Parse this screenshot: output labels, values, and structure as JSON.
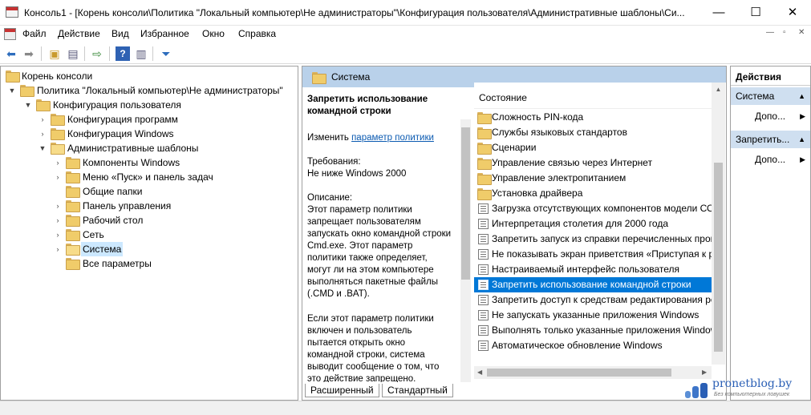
{
  "window": {
    "title": "Консоль1 - [Корень консоли\\Политика \"Локальный компьютер\\Не администраторы\"\\Конфигурация пользователя\\Административные шаблоны\\Си...",
    "minimize": "—",
    "maximize": "☐",
    "close": "✕"
  },
  "menu": {
    "items": [
      "Файл",
      "Действие",
      "Вид",
      "Избранное",
      "Окно",
      "Справка"
    ],
    "controls": [
      "—",
      "▫",
      "✕"
    ]
  },
  "toolbar": {
    "icons": [
      "back-arrow-icon",
      "forward-arrow-icon",
      "up-folder-icon",
      "show-hide-tree-icon",
      "export-list-icon",
      "help-icon",
      "show-hide-action-icon",
      "filter-icon"
    ]
  },
  "tree": {
    "items": [
      {
        "label": "Корень консоли"
      },
      {
        "label": "Политика \"Локальный компьютер\\Не администраторы\""
      },
      {
        "label": "Конфигурация пользователя"
      },
      {
        "label": "Конфигурация программ"
      },
      {
        "label": "Конфигурация Windows"
      },
      {
        "label": "Административные шаблоны"
      },
      {
        "label": "Компоненты Windows"
      },
      {
        "label": "Меню «Пуск» и панель задач"
      },
      {
        "label": "Общие папки"
      },
      {
        "label": "Панель управления"
      },
      {
        "label": "Рабочий стол"
      },
      {
        "label": "Сеть"
      },
      {
        "label": "Система"
      },
      {
        "label": "Все параметры"
      }
    ]
  },
  "middle": {
    "header": "Система",
    "desc": {
      "title": "Запретить использование командной строки",
      "edit_prefix": "Изменить",
      "edit_link": "параметр политики",
      "req_label": "Требования:",
      "req_value": "Не ниже Windows 2000",
      "desc_label": "Описание:",
      "desc_p1": "Этот параметр политики запрещает пользователям запускать окно командной строки Cmd.exe.  Этот параметр политики также определяет, могут ли на этом компьютере выполняться пакетные файлы (.CMD и .BAT).",
      "desc_p2": "Если этот параметр политики включен и пользователь пытается открыть окно командной строки, система выводит сообщение о том, что это действие запрещено."
    },
    "list_header": "Состояние",
    "items": [
      {
        "label": "Сложность PIN-кода"
      },
      {
        "label": "Службы языковых стандартов"
      },
      {
        "label": "Сценарии"
      },
      {
        "label": "Управление связью через Интернет"
      },
      {
        "label": "Управление электропитанием"
      },
      {
        "label": "Установка драйвера"
      },
      {
        "label": "Загрузка отсутствующих компонентов модели СОМ"
      },
      {
        "label": "Интерпретация столетия для 2000 года"
      },
      {
        "label": "Запретить запуск из справки перечисленных программ"
      },
      {
        "label": "Не показывать экран приветствия «Приступая к работе»"
      },
      {
        "label": "Настраиваемый интерфейс пользователя"
      },
      {
        "label": "Запретить использование командной строки"
      },
      {
        "label": "Запретить доступ к средствам редактирования реестра"
      },
      {
        "label": "Не запускать указанные приложения Windows"
      },
      {
        "label": "Выполнять только указанные приложения Windows"
      },
      {
        "label": "Автоматическое обновление Windows"
      }
    ],
    "tabs": [
      "Расширенный",
      "Стандартный"
    ]
  },
  "actions": {
    "header": "Действия",
    "groups": [
      {
        "title": "Система",
        "item": "Допо..."
      },
      {
        "title": "Запретить...",
        "item": "Допо..."
      }
    ]
  },
  "watermark": {
    "site": "pronetblog.by",
    "tagline": "Без компьютерных ловушек"
  },
  "colors": {
    "selection": "#0078d7",
    "header": "#b9d1ea",
    "link": "#0b5ab1"
  }
}
